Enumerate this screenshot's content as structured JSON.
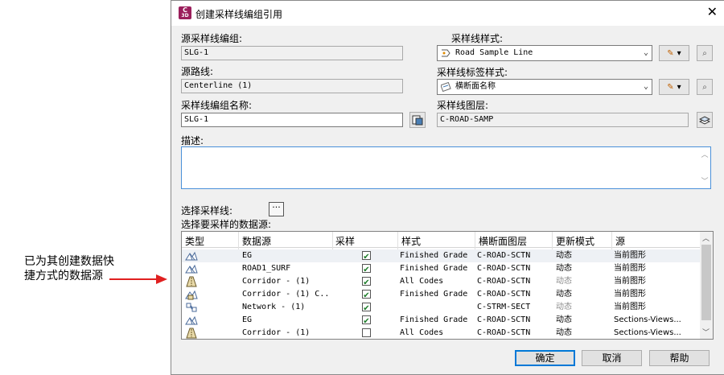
{
  "annotation": {
    "text": "已为其创建数据快捷方式的数据源"
  },
  "dialog": {
    "title": "创建采样线编组引用",
    "source_group": {
      "label": "源采样线编组:",
      "value": "SLG-1"
    },
    "source_alignment": {
      "label": "源路线:",
      "value": "Centerline (1)"
    },
    "group_name": {
      "label": "采样线编组名称:",
      "value": "SLG-1"
    },
    "sample_line_style": {
      "label": "采样线样式:",
      "value": "Road Sample Line"
    },
    "label_style": {
      "label": "采样线标签样式:",
      "value": "横断面名称"
    },
    "layer": {
      "label": "采样线图层:",
      "value": "C-ROAD-SAMP"
    },
    "description": {
      "label": "描述:",
      "value": ""
    },
    "select_lines": {
      "label": "选择采样线:",
      "button": "···"
    },
    "sources_label": "选择要采样的数据源:",
    "table": {
      "headers": [
        "类型",
        "数据源",
        "采样",
        "样式",
        "横断面图层",
        "更新模式",
        "源"
      ],
      "rows": [
        {
          "icon": "surface-icon",
          "name": "EG",
          "sample": true,
          "style": "Finished Grade",
          "layer": "C-ROAD-SCTN",
          "mode": "动态",
          "mode_grey": false,
          "source": "当前图形"
        },
        {
          "icon": "surface-icon",
          "name": "ROAD1_SURF",
          "sample": true,
          "style": "Finished Grade",
          "layer": "C-ROAD-SCTN",
          "mode": "动态",
          "mode_grey": false,
          "source": "当前图形"
        },
        {
          "icon": "corridor-icon",
          "name": "Corridor - (1)",
          "sample": true,
          "style": "All Codes",
          "layer": "C-ROAD-SCTN",
          "mode": "动态",
          "mode_grey": true,
          "source": "当前图形"
        },
        {
          "icon": "corridor-surface-icon",
          "name": "Corridor - (1) C...",
          "sample": true,
          "style": "Finished Grade",
          "layer": "C-ROAD-SCTN",
          "mode": "动态",
          "mode_grey": false,
          "source": "当前图形"
        },
        {
          "icon": "pipe-network-icon",
          "name": "Network - (1)",
          "sample": true,
          "style": "",
          "layer": "C-STRM-SECT",
          "mode": "动态",
          "mode_grey": true,
          "source": "当前图形"
        },
        {
          "icon": "surface-icon",
          "name": "EG",
          "sample": true,
          "style": "Finished Grade",
          "layer": "C-ROAD-SCTN",
          "mode": "动态",
          "mode_grey": false,
          "source": "Sections-Views..."
        },
        {
          "icon": "corridor-icon",
          "name": "Corridor - (1)",
          "sample": false,
          "style": "All Codes",
          "layer": "C-ROAD-SCTN",
          "mode": "动态",
          "mode_grey": false,
          "source": "Sections-Views..."
        }
      ]
    },
    "buttons": {
      "ok": "确定",
      "cancel": "取消",
      "help": "帮助"
    }
  },
  "colors": {
    "accent": "#0078d7",
    "arrow": "#e02020",
    "app_icon": "#9b1f5c"
  }
}
